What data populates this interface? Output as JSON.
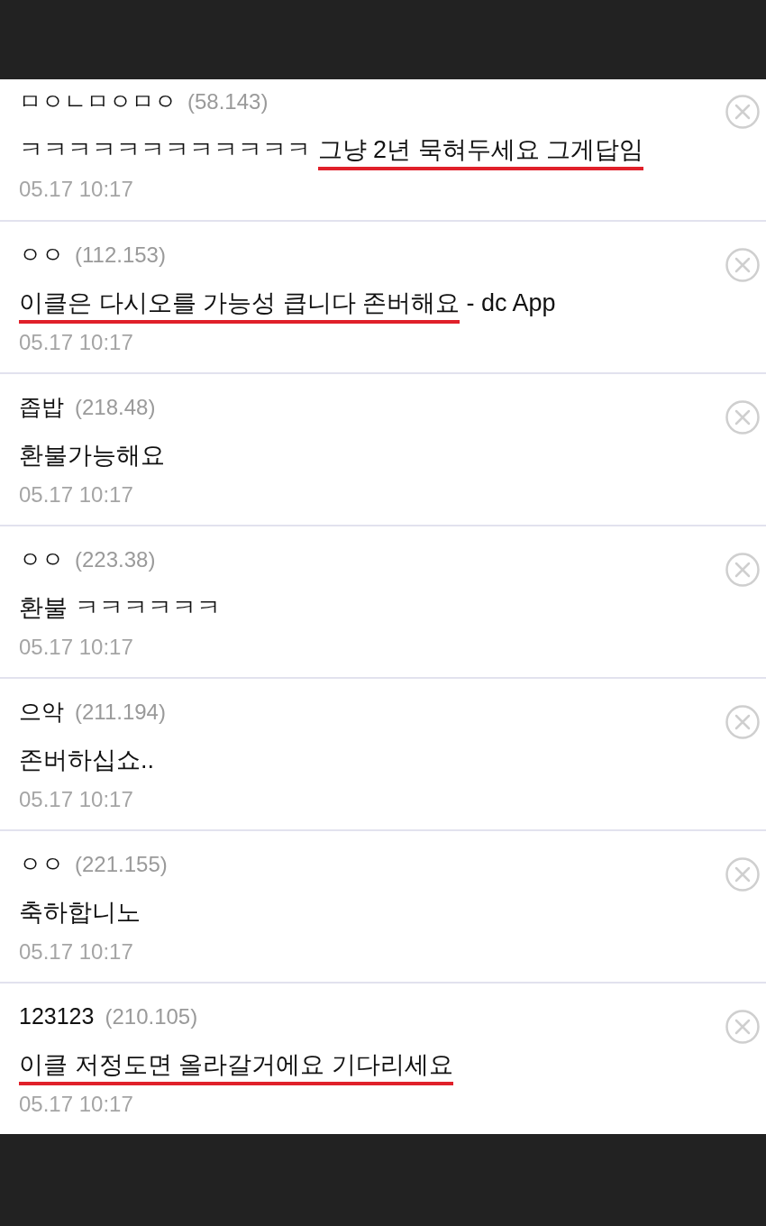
{
  "comments": [
    {
      "author": "ㅁㅇㄴㅁㅇㅁㅇ",
      "ip": "(58.143)",
      "segments": [
        {
          "text": "ㅋㅋㅋㅋㅋㅋㅋㅋㅋㅋㅋㅋ ",
          "underlined": false
        },
        {
          "text": "그냥 2년 묵혀두세요 그게답임",
          "underlined": true
        }
      ],
      "date": "05.17 10:17"
    },
    {
      "author": "ㅇㅇ",
      "ip": "(112.153)",
      "segments": [
        {
          "text": "이클은 다시오를 가능성 큽니다 존버해요",
          "underlined": true
        },
        {
          "text": " - dc App",
          "underlined": false
        }
      ],
      "date": "05.17 10:17"
    },
    {
      "author": "좁밥",
      "ip": "(218.48)",
      "segments": [
        {
          "text": "환불가능해요",
          "underlined": false
        }
      ],
      "date": "05.17 10:17"
    },
    {
      "author": "ㅇㅇ",
      "ip": "(223.38)",
      "segments": [
        {
          "text": "환불 ㅋㅋㅋㅋㅋㅋ",
          "underlined": false
        }
      ],
      "date": "05.17 10:17"
    },
    {
      "author": "으악",
      "ip": "(211.194)",
      "segments": [
        {
          "text": "존버하십쇼..",
          "underlined": false
        }
      ],
      "date": "05.17 10:17"
    },
    {
      "author": "ㅇㅇ",
      "ip": "(221.155)",
      "segments": [
        {
          "text": "축하합니노",
          "underlined": false
        }
      ],
      "date": "05.17 10:17"
    },
    {
      "author": "123123",
      "ip": "(210.105)",
      "segments": [
        {
          "text": "이클 저정도면 올라갈거에요 기다리세요",
          "underlined": true
        }
      ],
      "date": "05.17 10:17"
    }
  ]
}
